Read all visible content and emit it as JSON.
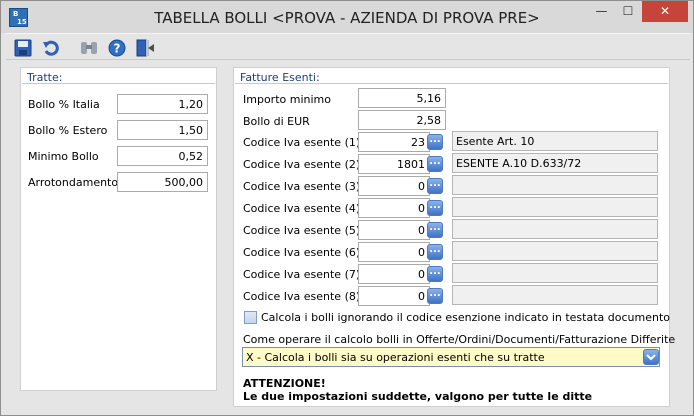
{
  "window": {
    "app_icon_text_top": "B",
    "app_icon_text_bottom": "15",
    "title": "TABELLA BOLLI <PROVA - AZIENDA DI PROVA PRE>",
    "minimize_glyph": "—",
    "maximize_glyph": "☐",
    "close_glyph": "✕"
  },
  "toolbar": {
    "icons": [
      "save-icon",
      "undo-icon",
      "search-icon",
      "help-icon",
      "exit-icon"
    ]
  },
  "tratte": {
    "title": "Tratte:",
    "fields": [
      {
        "label": "Bollo % Italia",
        "value": "1,20"
      },
      {
        "label": "Bollo % Estero",
        "value": "1,50"
      },
      {
        "label": "Minimo Bollo",
        "value": "0,52"
      },
      {
        "label": "Arrotondamento",
        "value": "500,00"
      }
    ]
  },
  "fatture": {
    "title": "Fatture Esenti:",
    "importo_label": "Importo minimo",
    "importo_value": "5,16",
    "bollo_label": "Bollo di EUR",
    "bollo_value": "2,58",
    "codici": [
      {
        "label": "Codice Iva esente (1)",
        "value": "23",
        "desc": "Esente Art. 10"
      },
      {
        "label": "Codice Iva esente (2)",
        "value": "1801",
        "desc": "ESENTE A.10 D.633/72"
      },
      {
        "label": "Codice Iva esente (3)",
        "value": "0",
        "desc": ""
      },
      {
        "label": "Codice Iva esente (4)",
        "value": "0",
        "desc": ""
      },
      {
        "label": "Codice Iva esente (5)",
        "value": "0",
        "desc": ""
      },
      {
        "label": "Codice Iva esente (6)",
        "value": "0",
        "desc": ""
      },
      {
        "label": "Codice Iva esente (7)",
        "value": "0",
        "desc": ""
      },
      {
        "label": "Codice Iva esente (8)",
        "value": "0",
        "desc": ""
      }
    ],
    "lookup_glyph": "...",
    "checkbox_label": "Calcola i bolli ignorando il codice esenzione indicato in testata documento",
    "checkbox_checked": false,
    "combo_caption": "Come operare il calcolo bolli in Offerte/Ordini/Documenti/Fatturazione Differite",
    "combo_value": "X - Calcola i bolli sia su operazioni esenti che su tratte",
    "warning_title": "ATTENZIONE!",
    "warning_text": "Le due impostazioni suddette, valgono per tutte le ditte"
  },
  "colors": {
    "group_title": "#1e3d78",
    "combo_background": "#fffbc8",
    "close_button": "#c7443b"
  }
}
